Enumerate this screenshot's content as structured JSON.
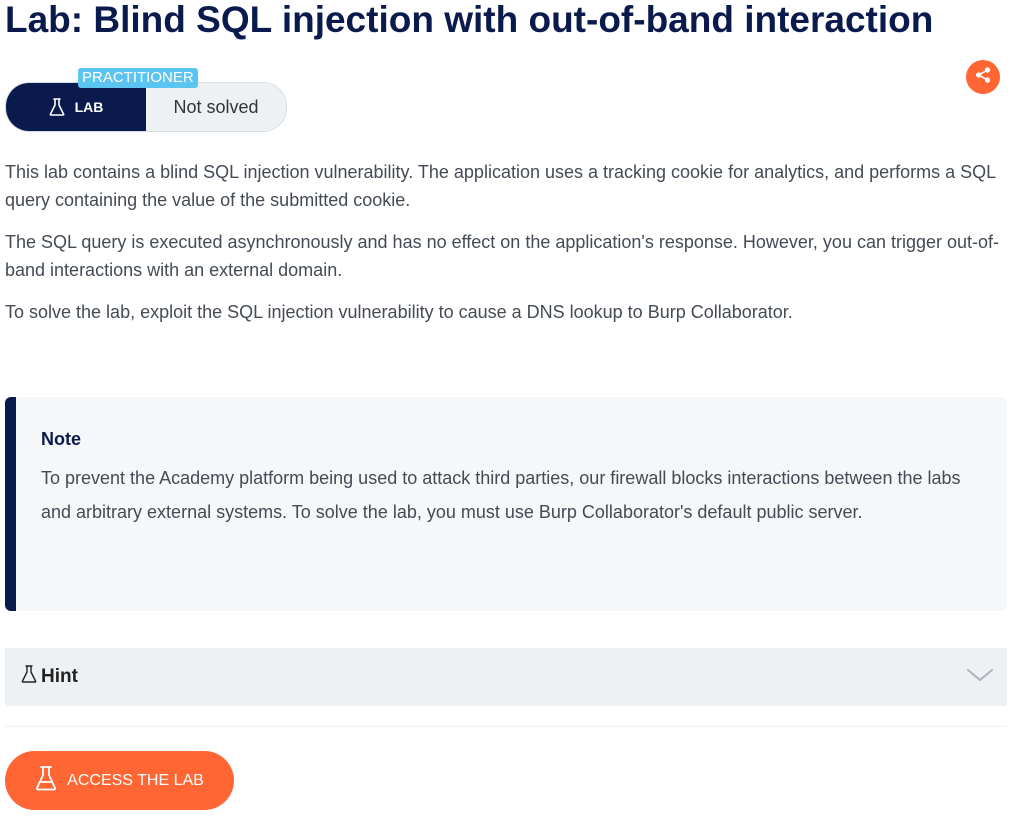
{
  "title": "Lab: Blind SQL injection with out-of-band interaction",
  "badge": {
    "level": "PRACTITIONER",
    "type_label": "LAB",
    "status": "Not solved",
    "icon": "flask-icon"
  },
  "share": {
    "icon": "share-icon"
  },
  "description": [
    "This lab contains a blind SQL injection vulnerability. The application uses a tracking cookie for analytics, and performs a SQL query containing the value of the submitted cookie.",
    "The SQL query is executed asynchronously and has no effect on the application's response. However, you can trigger out-of-band interactions with an external domain.",
    "To solve the lab, exploit the SQL injection vulnerability to cause a DNS lookup to Burp Collaborator."
  ],
  "note": {
    "title": "Note",
    "body": "To prevent the Academy platform being used to attack third parties, our firewall blocks interactions between the labs and arbitrary external systems. To solve the lab, you must use Burp Collaborator's default public server."
  },
  "hint": {
    "label": "Hint",
    "icon": "flask-icon",
    "chevron": "chevron-down-icon"
  },
  "access_button": {
    "label": "ACCESS THE LAB",
    "icon": "flask-icon"
  },
  "colors": {
    "navy": "#0a1a4d",
    "orange": "#ff6633",
    "level_blue": "#5cc4f0",
    "panel_gray": "#eef1f4",
    "note_bg": "#f5f7f9"
  }
}
